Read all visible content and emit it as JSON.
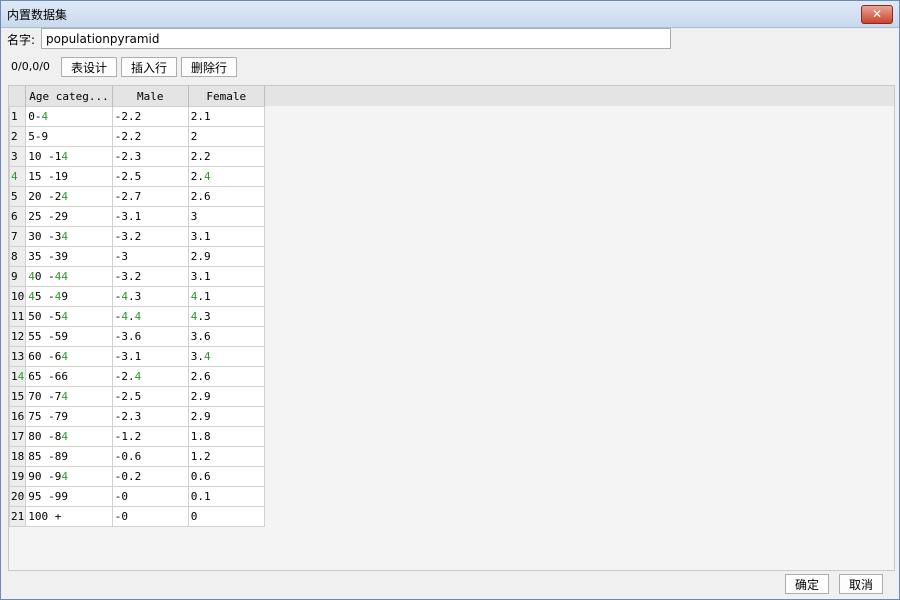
{
  "window": {
    "title": "内置数据集"
  },
  "name_field": {
    "label": "名字:",
    "value": "populationpyramid"
  },
  "toolbar": {
    "coords": "0/0,0/0",
    "table_design": "表设计",
    "insert_row": "插入行",
    "delete_row": "删除行"
  },
  "table": {
    "columns": [
      "Age categ...",
      "Male",
      "Female"
    ],
    "rows": [
      [
        "0-4",
        "-2.2",
        "2.1"
      ],
      [
        "5-9",
        "-2.2",
        "2"
      ],
      [
        "10 -14",
        "-2.3",
        "2.2"
      ],
      [
        "15 -19",
        "-2.5",
        "2.4"
      ],
      [
        "20 -24",
        "-2.7",
        "2.6"
      ],
      [
        "25 -29",
        "-3.1",
        "3"
      ],
      [
        "30 -34",
        "-3.2",
        "3.1"
      ],
      [
        "35 -39",
        "-3",
        "2.9"
      ],
      [
        "40 -44",
        "-3.2",
        "3.1"
      ],
      [
        "45 -49",
        "-4.3",
        "4.1"
      ],
      [
        "50 -54",
        "-4.4",
        "4.3"
      ],
      [
        "55 -59",
        "-3.6",
        "3.6"
      ],
      [
        "60 -64",
        "-3.1",
        "3.4"
      ],
      [
        "65 -66",
        "-2.4",
        "2.6"
      ],
      [
        "70 -74",
        "-2.5",
        "2.9"
      ],
      [
        "75 -79",
        "-2.3",
        "2.9"
      ],
      [
        "80 -84",
        "-1.2",
        "1.8"
      ],
      [
        "85 -89",
        "-0.6",
        "1.2"
      ],
      [
        "90 -94",
        "-0.2",
        "0.6"
      ],
      [
        "95 -99",
        "-0",
        "0.1"
      ],
      [
        "100 +",
        "-0",
        "0"
      ]
    ]
  },
  "footer": {
    "ok": "确定",
    "cancel": "取消"
  },
  "colors": {
    "digit_highlight": "#2a9a2a",
    "close_button": "#c9432d"
  }
}
